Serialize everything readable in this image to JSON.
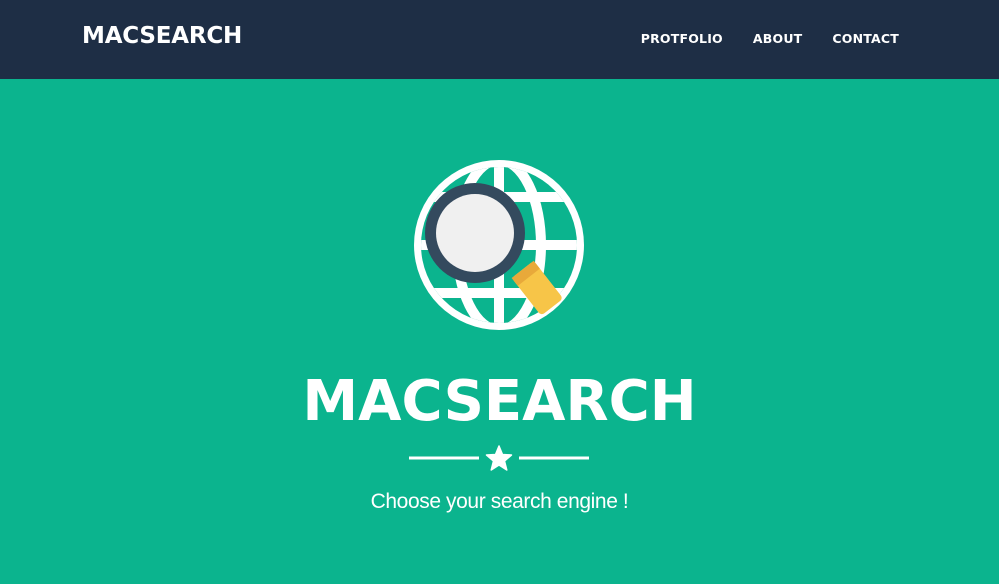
{
  "navbar": {
    "brand": "MACSEARCH",
    "links": [
      {
        "label": "PROTFOLIO"
      },
      {
        "label": "ABOUT"
      },
      {
        "label": "CONTACT"
      }
    ]
  },
  "hero": {
    "logo_icon": "globe-magnifier-icon",
    "divider_icon": "star-icon",
    "title": "MACSEARCH",
    "subtitle": "Choose your search engine !"
  },
  "colors": {
    "navbar_bg": "#1e2e45",
    "hero_bg": "#0bb48e",
    "text": "#ffffff",
    "magnifier_ring": "#344a5e",
    "magnifier_glass": "#f0f0f0",
    "magnifier_handle": "#f7c548"
  }
}
